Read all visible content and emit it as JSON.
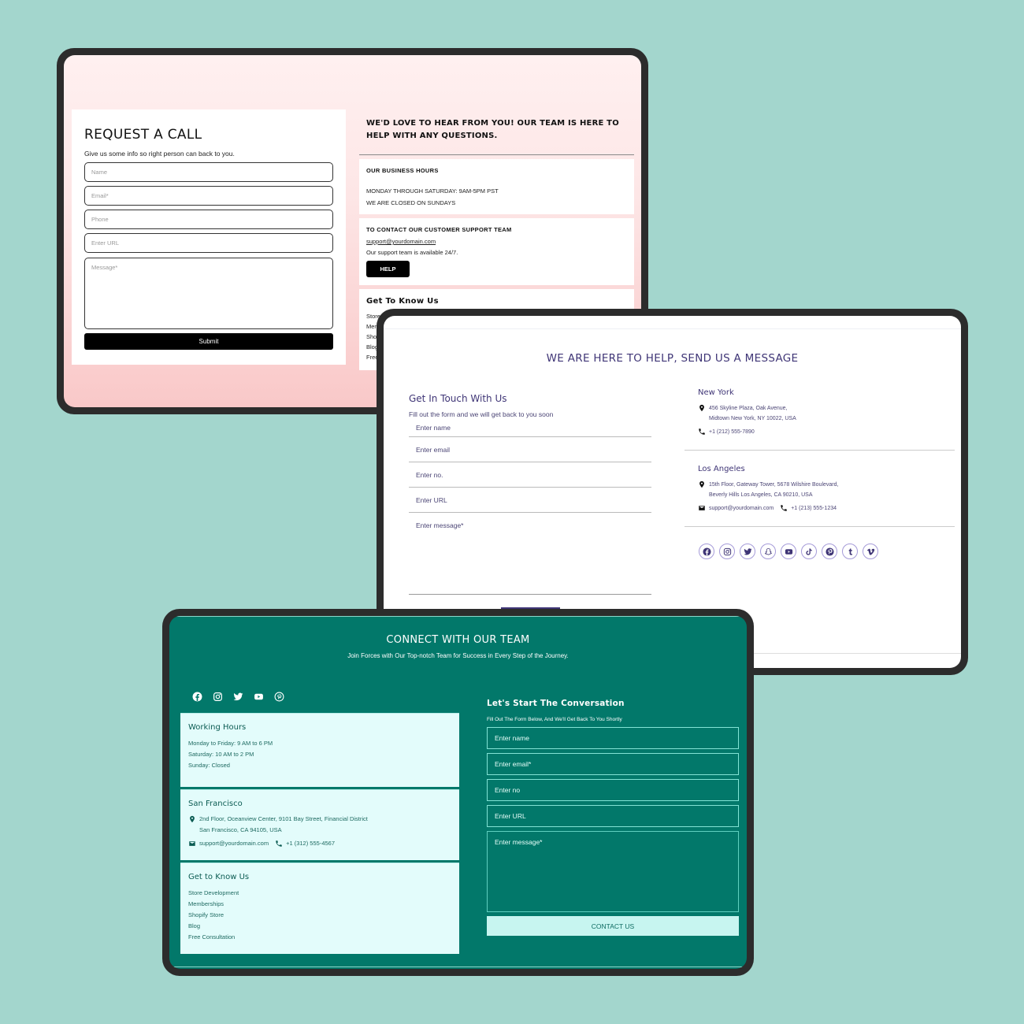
{
  "colors": {
    "background": "#a3d6cd",
    "device_frame": "#2c2c2c",
    "pink_accent": "#f9c8c8",
    "purple_accent": "#3f3576",
    "teal_accent": "#02786a",
    "teal_card": "#e3fcfb",
    "teal_button": "#c7f5f0"
  },
  "request_call": {
    "title": "REQUEST A CALL",
    "subtitle": "Give us some info so right person can back to you.",
    "fields": {
      "name_placeholder": "Name",
      "email_placeholder": "Email*",
      "phone_placeholder": "Phone",
      "url_placeholder": "Enter URL",
      "message_placeholder": "Message*"
    },
    "submit_label": "Submit",
    "intro": "WE'D LOVE TO HEAR FROM YOU! OUR TEAM IS HERE TO HELP WITH ANY QUESTIONS.",
    "business_hours": {
      "heading": "OUR BUSINESS HOURS",
      "line1": "MONDAY THROUGH SATURDAY: 9AM-5PM PST",
      "line2": "WE ARE CLOSED ON SUNDAYS"
    },
    "support": {
      "heading": "TO CONTACT OUR CUSTOMER SUPPORT TEAM",
      "email": "support@yourdomain.com",
      "note": "Our support team is available 24/7.",
      "help_label": "HELP"
    },
    "get_to_know": {
      "heading": "Get To Know Us",
      "links": [
        "Store Development",
        "Memberships",
        "Shopify Store",
        "Blog",
        "Free Consultation"
      ]
    }
  },
  "help_message": {
    "title": "WE ARE HERE TO HELP, SEND US A MESSAGE",
    "form": {
      "heading": "Get In Touch With Us",
      "subtitle": "Fill out the form and we will get back to you soon",
      "name_placeholder": "Enter name",
      "email_placeholder": "Enter email",
      "phone_placeholder": "Enter no.",
      "url_placeholder": "Enter URL",
      "message_placeholder": "Enter message*"
    },
    "locations": [
      {
        "city": "New York",
        "address_line1": "456 Skyline Plaza, Oak Avenue,",
        "address_line2": "Midtown New York, NY 10022, USA",
        "phone": "+1 (212) 555-7890"
      },
      {
        "city": "Los Angeles",
        "address_line1": "15th Floor, Gateway Tower, 5678 Wilshire Boulevard,",
        "address_line2": "Beverly Hills Los Angeles, CA 90210, USA",
        "email": "support@yourdomain.com",
        "phone": "+1 (213) 555-1234"
      }
    ],
    "social_icons": [
      "facebook-icon",
      "instagram-icon",
      "twitter-icon",
      "snapchat-icon",
      "youtube-icon",
      "tiktok-icon",
      "pinterest-icon",
      "tumblr-icon",
      "vimeo-icon"
    ]
  },
  "connect_team": {
    "title": "CONNECT WITH OUR TEAM",
    "subtitle": "Join Forces with Our Top-notch Team for Success in Every Step of the Journey.",
    "social_icons": [
      "facebook-icon",
      "instagram-icon",
      "twitter-icon",
      "youtube-icon",
      "pinterest-icon"
    ],
    "working_hours": {
      "heading": "Working Hours",
      "lines": [
        "Monday to Friday: 9 AM to 6 PM",
        "Saturday: 10 AM to 2 PM",
        "Sunday: Closed"
      ]
    },
    "location": {
      "city": "San Francisco",
      "address_line1": "2nd Floor, Oceanview Center, 9101 Bay Street, Financial District",
      "address_line2": "San Francisco, CA 94105, USA",
      "email": "support@yourdomain.com",
      "phone": "+1 (312) 555-4567"
    },
    "get_to_know": {
      "heading": "Get to Know Us",
      "links": [
        "Store Development",
        "Memberships",
        "Shopify Store",
        "Blog",
        "Free Consultation"
      ]
    },
    "form": {
      "heading": "Let's Start The Conversation",
      "subtitle": "Fill Out The Form Below, And We'll Get Back To You Shortly",
      "name_placeholder": "Enter name",
      "email_placeholder": "Enter email*",
      "phone_placeholder": "Enter no",
      "url_placeholder": "Enter URL",
      "message_placeholder": "Enter message*",
      "submit_label": "CONTACT US"
    }
  }
}
